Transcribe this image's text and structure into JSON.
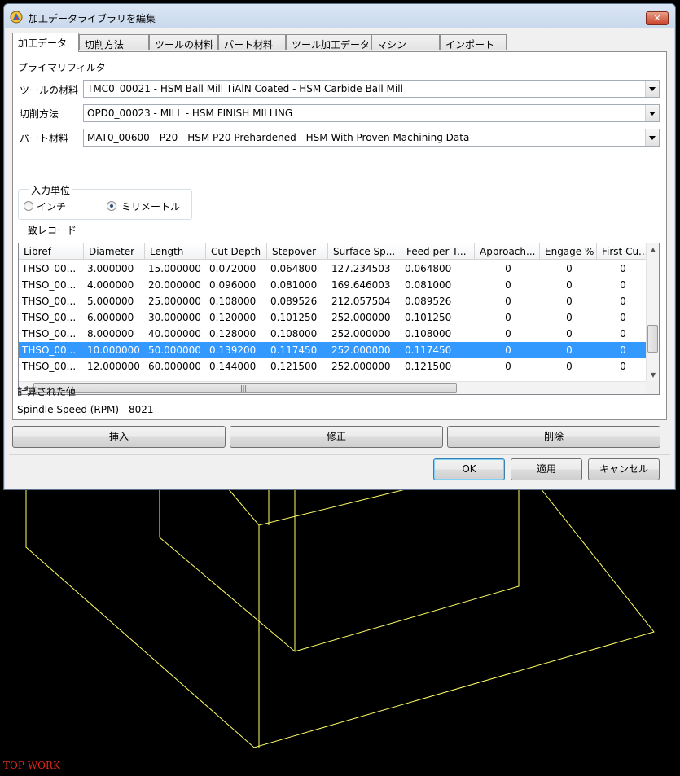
{
  "window": {
    "title": "加工データライブラリを編集",
    "close_label": "✕"
  },
  "tabs": [
    {
      "label": "加工データ",
      "active": true
    },
    {
      "label": "切削方法",
      "active": false
    },
    {
      "label": "ツールの材料",
      "active": false
    },
    {
      "label": "パート材料",
      "active": false
    },
    {
      "label": "ツール加工データ",
      "active": false
    },
    {
      "label": "マシン",
      "active": false
    },
    {
      "label": "インポート",
      "active": false
    }
  ],
  "primary_filter": {
    "heading": "プライマリフィルタ",
    "tool_material": {
      "label": "ツールの材料",
      "value": "TMC0_00021 - HSM Ball Mill TiAlN Coated - HSM Carbide Ball Mill"
    },
    "cutting_method": {
      "label": "切削方法",
      "value": "OPD0_00023 - MILL - HSM FINISH MILLING"
    },
    "part_material": {
      "label": "パート材料",
      "value": "MAT0_00600 - P20 - HSM P20 Prehardened - HSM With Proven Machining Data"
    }
  },
  "input_unit": {
    "title": "入力単位",
    "options": [
      {
        "label": "インチ",
        "checked": false
      },
      {
        "label": "ミリメートル",
        "checked": true
      }
    ]
  },
  "matching_records": {
    "heading": "一致レコード",
    "columns": [
      "Libref",
      "Diameter",
      "Length",
      "Cut Depth",
      "Stepover",
      "Surface Sp...",
      "Feed per T...",
      "Approach...",
      "Engage %",
      "First Cu..."
    ],
    "rows": [
      {
        "cells": [
          "THSO_00...",
          "3.000000",
          "15.000000",
          "0.072000",
          "0.064800",
          "127.234503",
          "0.064800",
          "0",
          "0",
          "0"
        ],
        "selected": false
      },
      {
        "cells": [
          "THSO_00...",
          "4.000000",
          "20.000000",
          "0.096000",
          "0.081000",
          "169.646003",
          "0.081000",
          "0",
          "0",
          "0"
        ],
        "selected": false
      },
      {
        "cells": [
          "THSO_00...",
          "5.000000",
          "25.000000",
          "0.108000",
          "0.089526",
          "212.057504",
          "0.089526",
          "0",
          "0",
          "0"
        ],
        "selected": false
      },
      {
        "cells": [
          "THSO_00...",
          "6.000000",
          "30.000000",
          "0.120000",
          "0.101250",
          "252.000000",
          "0.101250",
          "0",
          "0",
          "0"
        ],
        "selected": false
      },
      {
        "cells": [
          "THSO_00...",
          "8.000000",
          "40.000000",
          "0.128000",
          "0.108000",
          "252.000000",
          "0.108000",
          "0",
          "0",
          "0"
        ],
        "selected": false
      },
      {
        "cells": [
          "THSO_00...",
          "10.000000",
          "50.000000",
          "0.139200",
          "0.117450",
          "252.000000",
          "0.117450",
          "0",
          "0",
          "0"
        ],
        "selected": true
      },
      {
        "cells": [
          "THSO_00...",
          "12.000000",
          "60.000000",
          "0.144000",
          "0.121500",
          "252.000000",
          "0.121500",
          "0",
          "0",
          "0"
        ],
        "selected": false
      }
    ]
  },
  "calculated": {
    "heading": "計算された値",
    "value": "Spindle Speed (RPM) - 8021"
  },
  "record_buttons": {
    "insert": "挿入",
    "modify": "修正",
    "delete": "削除"
  },
  "dialog_buttons": {
    "ok": "OK",
    "apply": "適用",
    "cancel": "キャンセル"
  },
  "viewport": {
    "view_label": "TOP WORK",
    "wire_color": "#ffff66"
  },
  "colors": {
    "selection": "#3399ff",
    "view_label": "#e0281f"
  }
}
